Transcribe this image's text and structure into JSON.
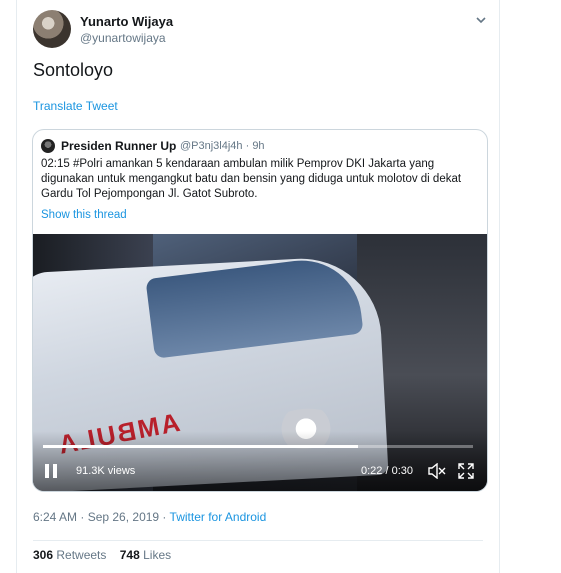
{
  "tweet": {
    "author_name": "Yunarto Wijaya",
    "author_handle": "@yunartowijaya",
    "text": "Sontoloyo",
    "translate_label": "Translate Tweet",
    "timestamp": "6:24 AM · Sep 26, 2019 · ",
    "source": "Twitter for Android"
  },
  "quoted": {
    "author_name": "Presiden Runner Up",
    "author_handle": "@P3nj3l4j4h · 9h",
    "text": "02:15 #Polri amankan 5 kendaraan ambulan milik Pemprov DKI Jakarta yang digunakan untuk mengangkut batu dan bensin yang diduga untuk molotov di dekat Gardu Tol Pejompongan Jl. Gatot Subroto.",
    "show_thread_label": "Show this thread"
  },
  "video": {
    "overlay_text": "AMBULA",
    "views": "91.3K views",
    "time": "0:22 / 0:30",
    "progress_fraction": 0.733
  },
  "stats": {
    "retweets_count": "306",
    "retweets_label": " Retweets",
    "likes_count": "748",
    "likes_label": " Likes"
  },
  "colors": {
    "accent": "#1b95e0",
    "secondary_text": "#657786",
    "ambulance_red": "#b8202b"
  },
  "icons": {
    "caret": "chevron-down-icon",
    "pause": "pause-icon",
    "mute": "mute-icon",
    "fullscreen": "fullscreen-icon"
  }
}
